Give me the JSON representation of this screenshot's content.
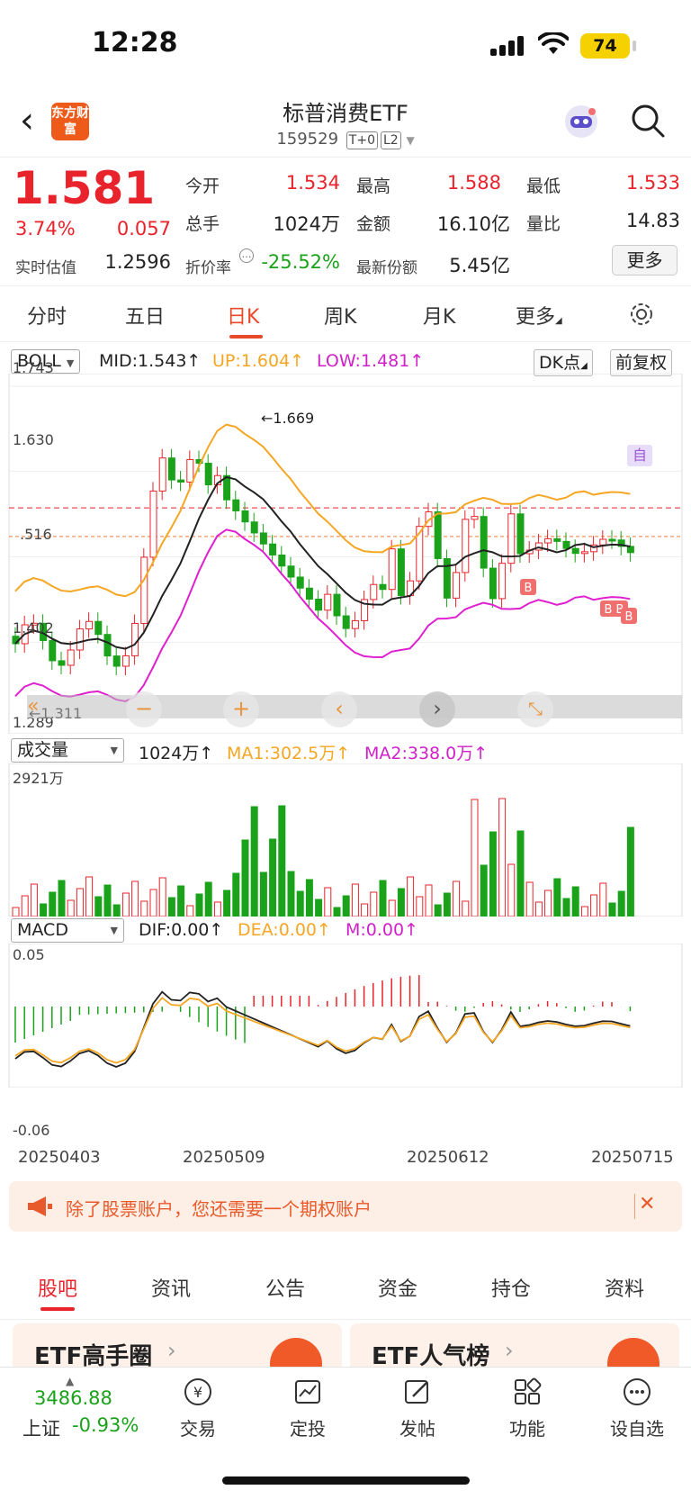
{
  "status": {
    "time": "12:28",
    "battery": "74"
  },
  "header": {
    "logo": "东方财富",
    "title": "标普消费ETF",
    "code": "159529",
    "tag1": "T+0",
    "tag2": "L2"
  },
  "quote": {
    "price": "1.581",
    "pct": "3.74%",
    "chg": "0.057",
    "iopv_label": "实时估值",
    "iopv": "1.2596",
    "open_label": "今开",
    "open": "1.534",
    "high_label": "最高",
    "high": "1.588",
    "low_label": "最低",
    "low": "1.533",
    "vol_label": "总手",
    "vol": "1024万",
    "amt_label": "金额",
    "amt": "16.10亿",
    "ratio_label": "量比",
    "ratio": "14.83",
    "disc_label": "折价率",
    "disc": "-25.52%",
    "shares_label": "最新份额",
    "shares": "5.45亿",
    "more": "更多"
  },
  "tabs": [
    "分时",
    "五日",
    "日K",
    "周K",
    "月K",
    "更多"
  ],
  "boll": {
    "name": "BOLL",
    "mid": "MID:1.543",
    "up": "UP:1.604",
    "low": "LOW:1.481",
    "dk": "DK点",
    "adj": "前复权"
  },
  "price_axis": [
    "1.743",
    "1.630",
    ".516",
    "1.402",
    "1.289"
  ],
  "annot": {
    "high": "1.669",
    "low": "1.311",
    "self": "自",
    "buy": "B"
  },
  "volume": {
    "name": "成交量",
    "val": "1024万",
    "ma1": "MA1:302.5万",
    "ma2": "MA2:338.0万",
    "max": "2921万"
  },
  "macd": {
    "name": "MACD",
    "dif": "DIF:0.00",
    "dea": "DEA:0.00",
    "m": "M:0.00",
    "top": "0.05",
    "bottom": "-0.06"
  },
  "dates": [
    "20250403",
    "20250509",
    "20250612",
    "20250715"
  ],
  "banner": {
    "text": "除了股票账户，您还需要一个期权账户"
  },
  "lower_tabs": [
    "股吧",
    "资讯",
    "公告",
    "资金",
    "持仓",
    "资料"
  ],
  "cards": {
    "left": "ETF高手圈",
    "right": "ETF人气榜"
  },
  "bottom": {
    "index_value": "3486.88",
    "index_name": "上证",
    "index_pct": "-0.93%",
    "items": [
      {
        "label": "交易",
        "icon": "yen-icon"
      },
      {
        "label": "定投",
        "icon": "chart-icon"
      },
      {
        "label": "发帖",
        "icon": "edit-icon"
      },
      {
        "label": "功能",
        "icon": "grid-icon"
      },
      {
        "label": "设自选",
        "icon": "more-icon"
      }
    ]
  },
  "colors": {
    "up": "#e8232b",
    "down": "#1aa31a",
    "accent": "#e8492b",
    "mid_line": "#222222",
    "up_line": "#f5a623",
    "low_line": "#e020d0"
  }
}
